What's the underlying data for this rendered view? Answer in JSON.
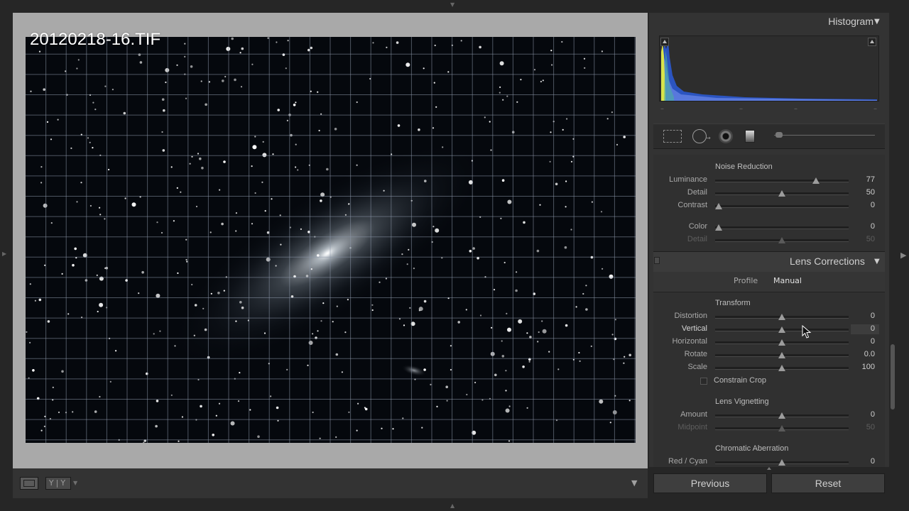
{
  "photo": {
    "file_name": "20120218-16.TIF"
  },
  "histogram": {
    "title": "Histogram",
    "dashes": [
      "–",
      "–",
      "–",
      "–"
    ]
  },
  "toolbar": {
    "compare_label": "Y|Y"
  },
  "noise_reduction": {
    "title": "Noise Reduction",
    "rows": [
      {
        "label": "Luminance",
        "value": "77",
        "fraction": 0.77,
        "enabled": true
      },
      {
        "label": "Detail",
        "value": "50",
        "fraction": 0.5,
        "enabled": true
      },
      {
        "label": "Contrast",
        "value": "0",
        "fraction": 0.0,
        "enabled": true
      },
      {
        "label": "Color",
        "value": "0",
        "fraction": 0.0,
        "enabled": true
      },
      {
        "label": "Detail",
        "value": "50",
        "fraction": 0.5,
        "enabled": false
      }
    ]
  },
  "lens_corrections": {
    "title": "Lens Corrections",
    "tabs": [
      "Profile",
      "Manual"
    ],
    "active_tab": "Manual",
    "transform": {
      "title": "Transform",
      "rows": [
        {
          "label": "Distortion",
          "value": "0"
        },
        {
          "label": "Vertical",
          "value": "0"
        },
        {
          "label": "Horizontal",
          "value": "0"
        },
        {
          "label": "Rotate",
          "value": "0.0"
        },
        {
          "label": "Scale",
          "value": "100"
        }
      ],
      "constrain_crop": "Constrain Crop",
      "constrain_crop_checked": false
    },
    "vignetting": {
      "title": "Lens Vignetting",
      "rows": [
        {
          "label": "Amount",
          "value": "0",
          "enabled": true
        },
        {
          "label": "Midpoint",
          "value": "50",
          "enabled": false
        }
      ]
    },
    "chromatic": {
      "title": "Chromatic Aberration",
      "rows": [
        {
          "label": "Red / Cyan",
          "value": "0"
        }
      ]
    }
  },
  "buttons": {
    "previous": "Previous",
    "reset": "Reset"
  },
  "colors": {
    "panel": "#333333",
    "view_frame": "#a9a9a9",
    "photo_bg": "#05080d",
    "grid": "#8a96a8"
  },
  "icons": [
    "crop-overlay-icon",
    "spot-removal-icon",
    "red-eye-icon",
    "graduated-filter-icon",
    "loupe-view-icon",
    "compare-view-icon"
  ]
}
